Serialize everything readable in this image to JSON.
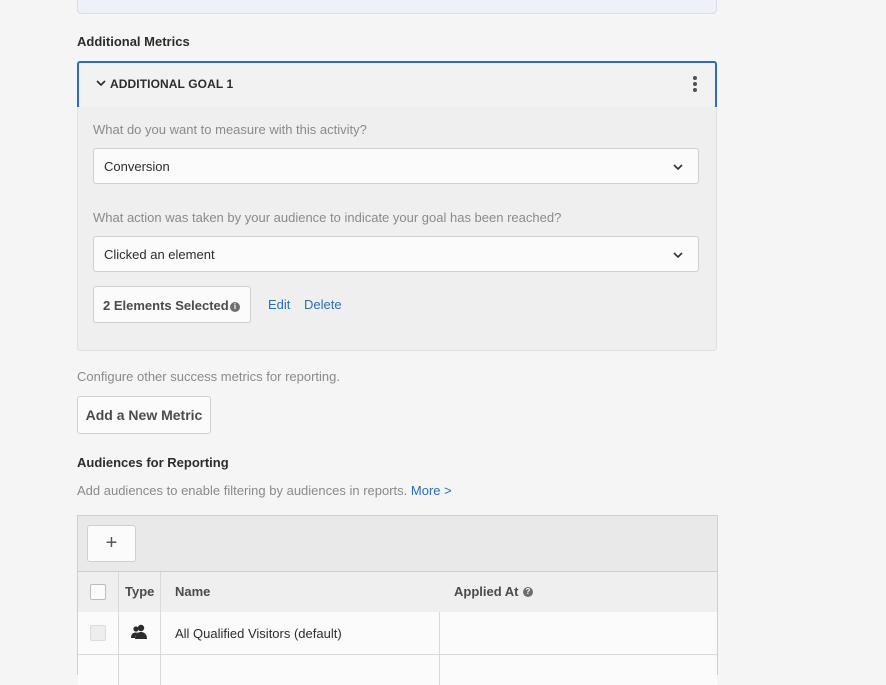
{
  "additional_metrics": {
    "heading": "Additional Metrics",
    "goal": {
      "title": "ADDITIONAL GOAL 1",
      "measure_question": "What do you want to measure with this activity?",
      "measure_value": "Conversion",
      "action_question": "What action was taken by your audience to indicate your goal has been reached?",
      "action_value": "Clicked an element",
      "elements_selected": "2 Elements Selected",
      "edit_label": "Edit",
      "delete_label": "Delete"
    },
    "help_text": "Configure other success metrics for reporting.",
    "add_metric_label": "Add a New Metric"
  },
  "audiences": {
    "heading": "Audiences for Reporting",
    "help_text": "Add audiences to enable filtering by audiences in reports.",
    "more_link": "More >",
    "add_button": "+",
    "columns": {
      "type": "Type",
      "name": "Name",
      "applied_at": "Applied At"
    },
    "rows": [
      {
        "name": "All Qualified Visitors (default)",
        "type_icon": "users-icon",
        "applied_at": ""
      }
    ]
  },
  "colors": {
    "accent": "#2b6dba",
    "background": "#f5f5f5"
  }
}
